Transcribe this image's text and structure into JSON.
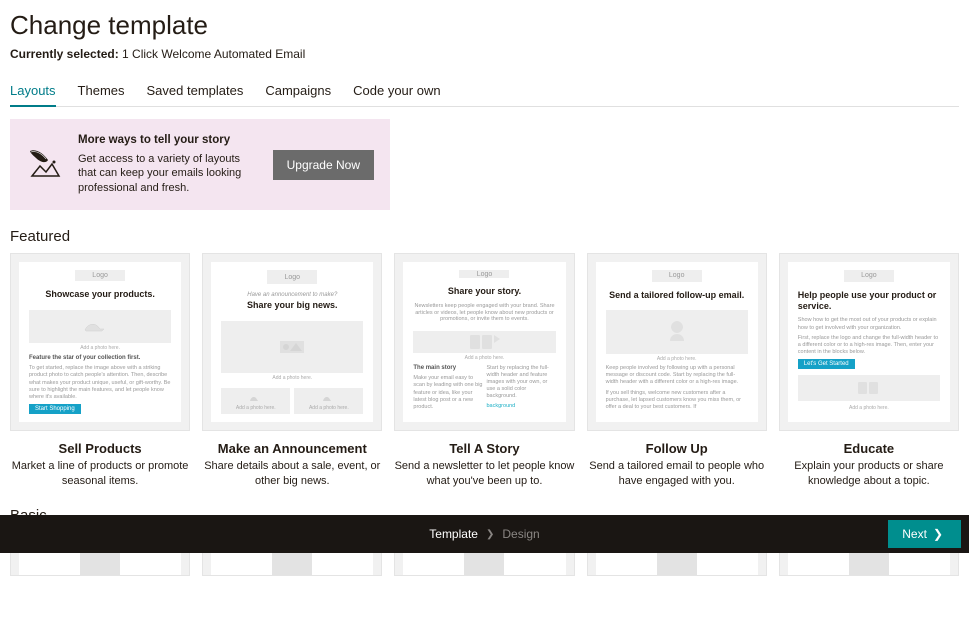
{
  "header": {
    "title": "Change template",
    "selected_label": "Currently selected:",
    "selected_value": "1 Click Welcome Automated Email"
  },
  "tabs": [
    "Layouts",
    "Themes",
    "Saved templates",
    "Campaigns",
    "Code your own"
  ],
  "active_tab": 0,
  "banner": {
    "title": "More ways to tell your story",
    "body": "Get access to a variety of layouts that can keep your emails looking professional and fresh.",
    "cta": "Upgrade Now"
  },
  "sections": {
    "featured": "Featured",
    "basic": "Basic"
  },
  "featured": [
    {
      "name": "Sell Products",
      "desc": "Market a line of products or promote seasonal items.",
      "preview": {
        "logo": "Logo",
        "headline": "Showcase your products.",
        "photo_text": "Add a photo here.",
        "lead": "Feature the star of your collection first.",
        "body": "To get started, replace the image above with a striking product photo to catch people's attention. Then, describe what makes your product unique, useful, or gift-worthy. Be sure to highlight the main features, and let people know where it's available.",
        "button": "Start Shopping"
      }
    },
    {
      "name": "Make an Announcement",
      "desc": "Share details about a sale, event, or other big news.",
      "preview": {
        "logo": "Logo",
        "sub": "Have an announcement to make?",
        "headline": "Share your big news.",
        "photo_text": "Add a photo here.",
        "mini_text": "Add a photo here."
      }
    },
    {
      "name": "Tell A Story",
      "desc": "Send a newsletter to let people know what you've been up to.",
      "preview": {
        "logo": "Logo",
        "headline": "Share your story.",
        "intro": "Newsletters keep people engaged with your brand. Share articles or videos, let people know about new products or promotions, or invite them to events.",
        "photo_text": "Add a photo here.",
        "lead": "The main story",
        "body": "Make your email easy to scan by leading with one big feature or idea, like your latest blog post or a new product.",
        "body2": "Start by replacing the full-width header and feature images with your own, or use a solid color background.",
        "link": "background"
      }
    },
    {
      "name": "Follow Up",
      "desc": "Send a tailored email to people who have engaged with you.",
      "preview": {
        "logo": "Logo",
        "headline": "Send a tailored follow-up email.",
        "photo_text": "Add a photo here.",
        "body": "Keep people involved by following up with a personal message or discount code. Start by replacing the full-width header with a different color or a high-res image.",
        "body2": "If you sell things, welcome new customers after a purchase, let lapsed customers know you miss them, or offer a deal to your best customers. If"
      }
    },
    {
      "name": "Educate",
      "desc": "Explain your products or share knowledge about a topic.",
      "preview": {
        "logo": "Logo",
        "headline": "Help people use your product or service.",
        "intro": "Show how to get the most out of your products or explain how to get involved with your organization.",
        "body": "First, replace the logo and change the full-width header to a different color or to a high-res image. Then, enter your content in the blocks below.",
        "button": "Let's Get Started",
        "photo_text": "Add a photo here."
      }
    }
  ],
  "footer": {
    "step1": "Template",
    "step2": "Design",
    "next": "Next"
  }
}
